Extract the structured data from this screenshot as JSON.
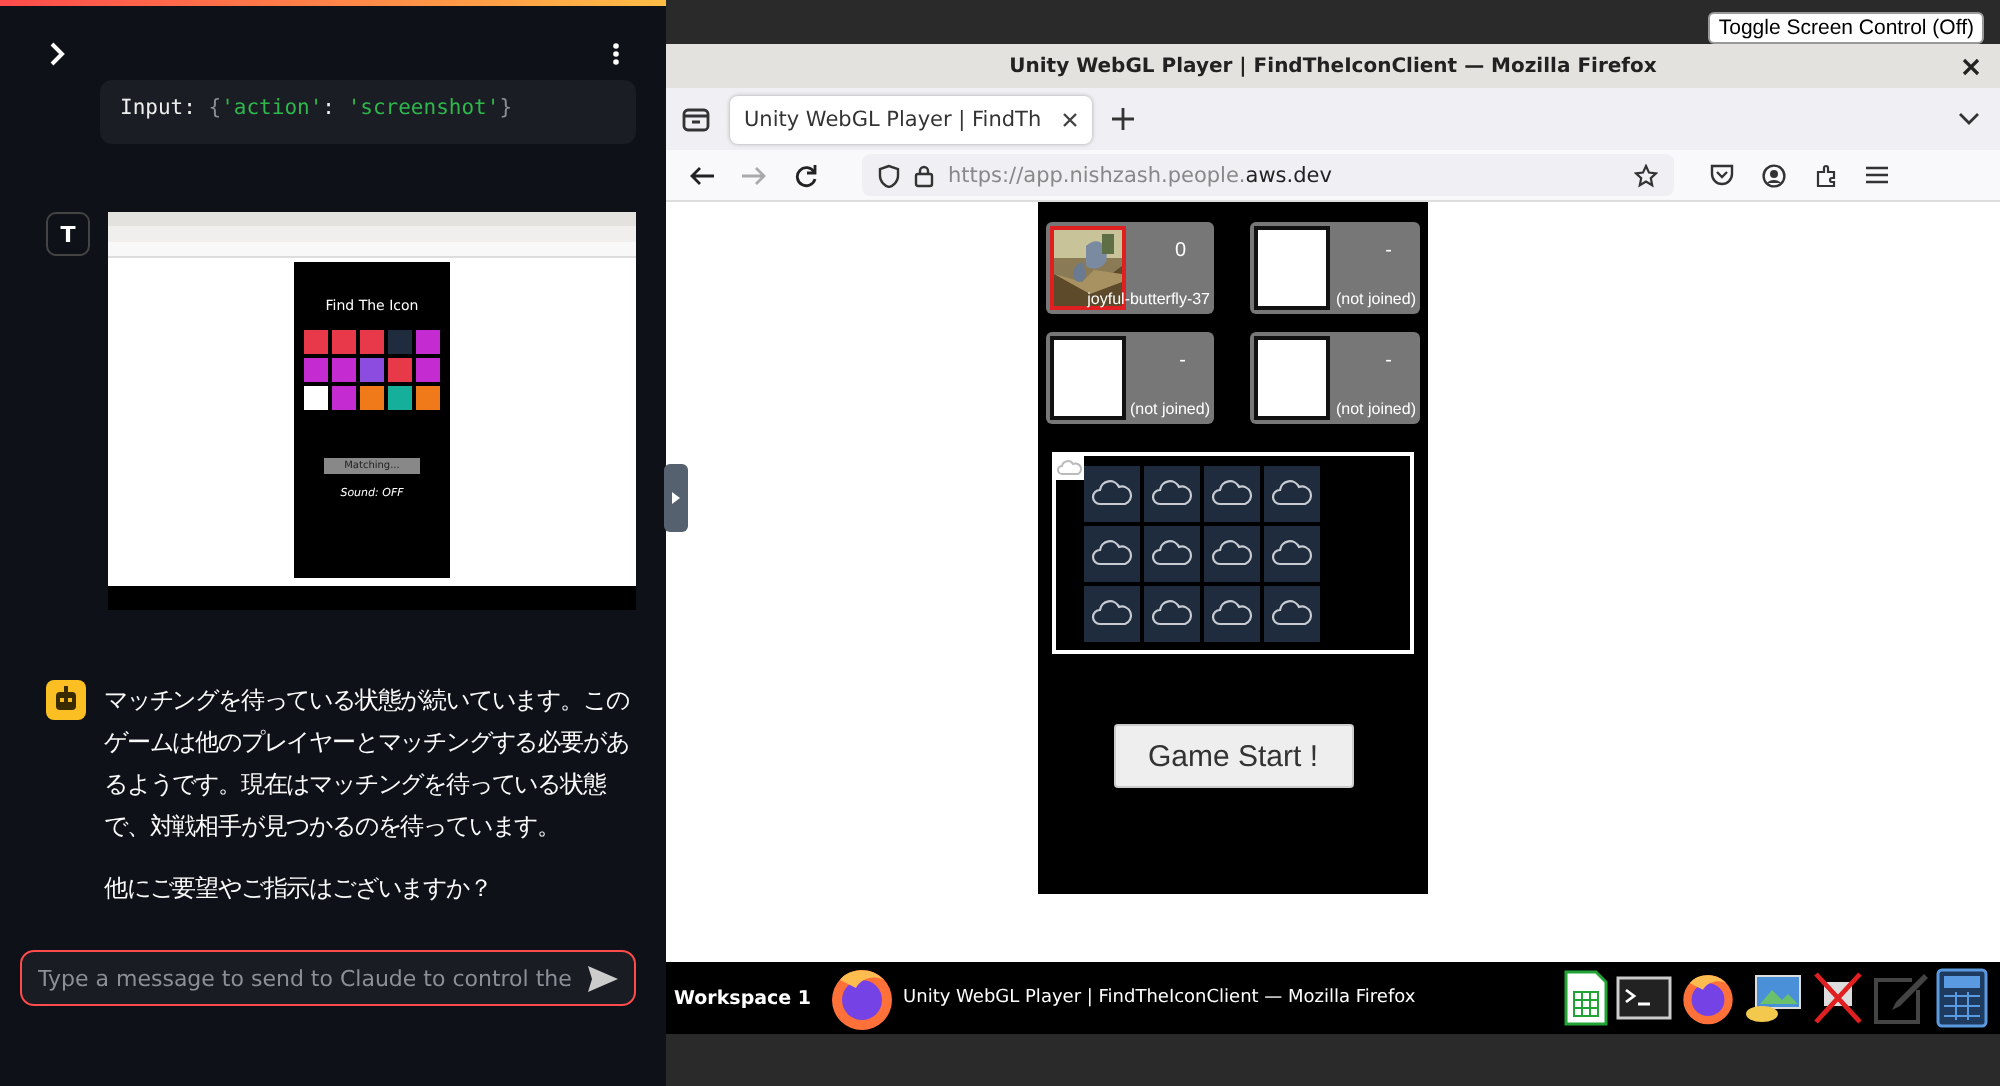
{
  "chat": {
    "tool_input": {
      "tokens": [
        {
          "kind": "plain",
          "text": "Input: "
        },
        {
          "kind": "punct",
          "text": "{"
        },
        {
          "kind": "string",
          "text": "'action'"
        },
        {
          "kind": "plain",
          "text": ": "
        },
        {
          "kind": "string",
          "text": "'screenshot'"
        },
        {
          "kind": "punct",
          "text": "}"
        }
      ]
    },
    "user_message": {
      "avatar": "T",
      "screenshot": {
        "game_title": "Find The Icon",
        "tiles": [
          {
            "color": "#e8394a"
          },
          {
            "color": "#e8394a"
          },
          {
            "color": "#e8394a"
          },
          {
            "color": "#1f2c3e"
          },
          {
            "color": "#c42bd1"
          },
          {
            "color": "#c42bd1"
          },
          {
            "color": "#c42bd1"
          },
          {
            "color": "#8c4ce0"
          },
          {
            "color": "#e8394a"
          },
          {
            "color": "#c42bd1"
          },
          {
            "color": "#ffffff"
          },
          {
            "color": "#c42bd1"
          },
          {
            "color": "#f07a1a"
          },
          {
            "color": "#16b09a"
          },
          {
            "color": "#f07a1a"
          }
        ],
        "status_button": "Matching...",
        "sound": "Sound: OFF"
      }
    },
    "assistant_message": {
      "paragraphs": [
        "マッチングを待っている状態が続いています。このゲームは他のプレイヤーとマッチングする必要があるようです。現在はマッチングを待っている状態で、対戦相手が見つかるのを待っています。",
        "他にご要望やご指示はございますか？"
      ]
    },
    "input": {
      "placeholder": "Type a message to send to Claude to control the"
    }
  },
  "toggle_button": "Toggle Screen Control (Off)",
  "browser": {
    "window_title": "Unity WebGL Player | FindTheIconClient — Mozilla Firefox",
    "tabs": [
      {
        "label": "Unity WebGL Player | FindTh",
        "selected": true
      }
    ],
    "url": {
      "prefix": "https://app.nishzash.people.",
      "domain": "aws.dev"
    },
    "game": {
      "players": [
        {
          "name": "joyful-butterfly-37",
          "score": "0",
          "joined": true
        },
        {
          "name": "(not joined)",
          "score": "-",
          "joined": false
        },
        {
          "name": "(not joined)",
          "score": "-",
          "joined": false
        },
        {
          "name": "(not joined)",
          "score": "-",
          "joined": false
        }
      ],
      "start_button": "Game Start !"
    }
  },
  "taskbar": {
    "workspace": "Workspace 1",
    "window": "Unity WebGL Player | FindTheIconClient — Mozilla Firefox"
  }
}
